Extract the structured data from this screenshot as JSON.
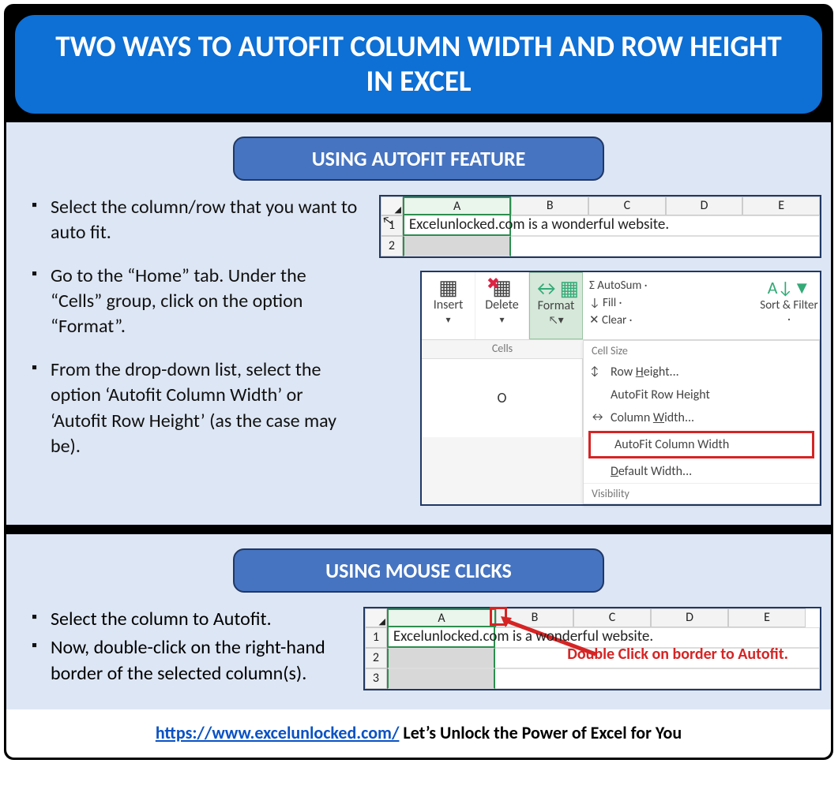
{
  "title": "TWO WAYS TO AUTOFIT COLUMN WIDTH AND ROW HEIGHT IN EXCEL",
  "section1": {
    "heading": "USING AUTOFIT FEATURE",
    "bullets": [
      "Select the column/row that you want to auto fit.",
      "Go to the “Home” tab. Under the “Cells” group, click on the option “Format”.",
      "From the drop-down list, select the option ‘Autofit Column Width’ or ‘Autofit Row Height’ (as the case may be)."
    ],
    "grid": {
      "cols": [
        "A",
        "B",
        "C",
        "D",
        "E"
      ],
      "rows": [
        "1",
        "2"
      ],
      "a1_text": "Excelunlocked.com is a wonderful website."
    },
    "ribbon": {
      "buttons": [
        "Insert",
        "Delete",
        "Format"
      ],
      "side": [
        "Σ AutoSum ·",
        "↓ Fill ·",
        "✕ Clear ·"
      ],
      "sort": "Sort & Filter ·",
      "group_label": "Cells",
      "menu_heading": "Cell Size",
      "menu_items": [
        {
          "label": "Row Height...",
          "icon": "↕"
        },
        {
          "label": "AutoFit Row Height",
          "icon": ""
        },
        {
          "label": "Column Width...",
          "icon": "↔"
        },
        {
          "label": "AutoFit Column Width",
          "icon": "",
          "boxed": true
        },
        {
          "label": "Default Width...",
          "icon": ""
        }
      ],
      "menu_footer": "Visibility"
    }
  },
  "section2": {
    "heading": "USING MOUSE CLICKS",
    "bullets": [
      "Select the column to Autofit.",
      "Now, double-click on the right-hand border of the selected column(s)."
    ],
    "grid": {
      "cols": [
        "A",
        "B",
        "C",
        "D",
        "E"
      ],
      "rows": [
        "1",
        "2",
        "3"
      ],
      "a1_text": "Excelunlocked.com is a wonderful website.",
      "callout": "Double Click on border to Autofit."
    }
  },
  "footer": {
    "url": "https://www.excelunlocked.com/",
    "tagline": " Let’s Unlock the Power of Excel for You"
  },
  "extra": {
    "col_o": "O"
  }
}
